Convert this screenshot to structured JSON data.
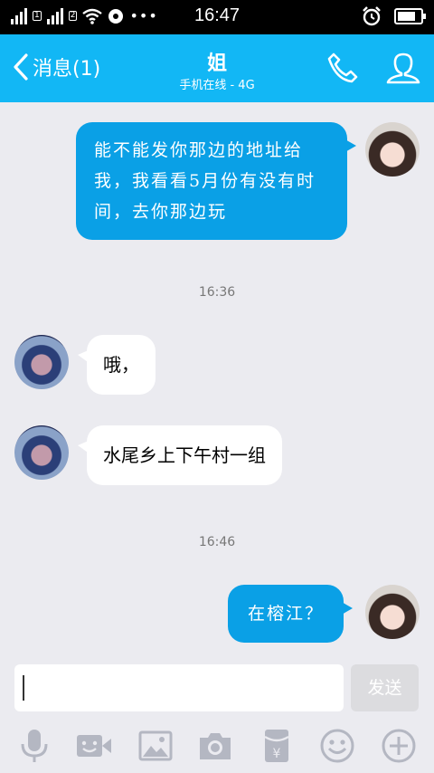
{
  "statusbar": {
    "sim1": "1",
    "sim2": "2",
    "more": "•••",
    "time": "16:47",
    "battery_level": 0.8
  },
  "header": {
    "back_label": "消息(1)",
    "title": "姐",
    "subtitle": "手机在线 - 4G",
    "icons": [
      "phone-icon",
      "profile-icon"
    ],
    "accent": "#12b7f5"
  },
  "messages": [
    {
      "from": "me",
      "text": "能不能发你那边的地址给我，我看看5月份有没有时间，去你那边玩"
    },
    {
      "timestamp": "16:36"
    },
    {
      "from": "other",
      "text": "哦，"
    },
    {
      "from": "other",
      "text": "水尾乡上下午村一组"
    },
    {
      "timestamp": "16:46"
    },
    {
      "from": "me",
      "text": "在榕江？"
    }
  ],
  "composer": {
    "value": "",
    "send_label": "发送",
    "tools": [
      "microphone-icon",
      "video-icon",
      "image-icon",
      "camera-icon",
      "red-packet-icon",
      "emoji-icon",
      "plus-icon"
    ]
  }
}
